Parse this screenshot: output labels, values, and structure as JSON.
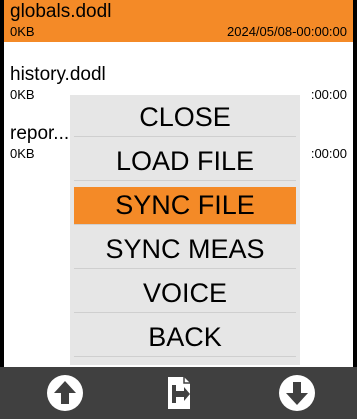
{
  "files": [
    {
      "name": "globals.dodl",
      "size": "0KB",
      "date": "2024/05/08-00:00:00",
      "selected": true
    },
    {
      "name": "history.dodl",
      "size": "0KB",
      "date": ":00:00",
      "selected": false
    },
    {
      "name": "repor........",
      "size": "0KB",
      "date": ":00:00",
      "selected": false
    }
  ],
  "menu": {
    "items": [
      {
        "label": "CLOSE"
      },
      {
        "label": "LOAD FILE"
      },
      {
        "label": "SYNC FILE"
      },
      {
        "label": "SYNC MEAS"
      },
      {
        "label": "VOICE"
      },
      {
        "label": "BACK"
      }
    ],
    "selected_index": 2
  },
  "bottom_bar": {
    "icons": [
      "arrow-up-circle-icon",
      "file-load-icon",
      "arrow-down-circle-icon"
    ]
  },
  "colors": {
    "accent": "#f48a27",
    "menu_bg": "#e6e6e6",
    "bottom_bar": "#404040"
  }
}
